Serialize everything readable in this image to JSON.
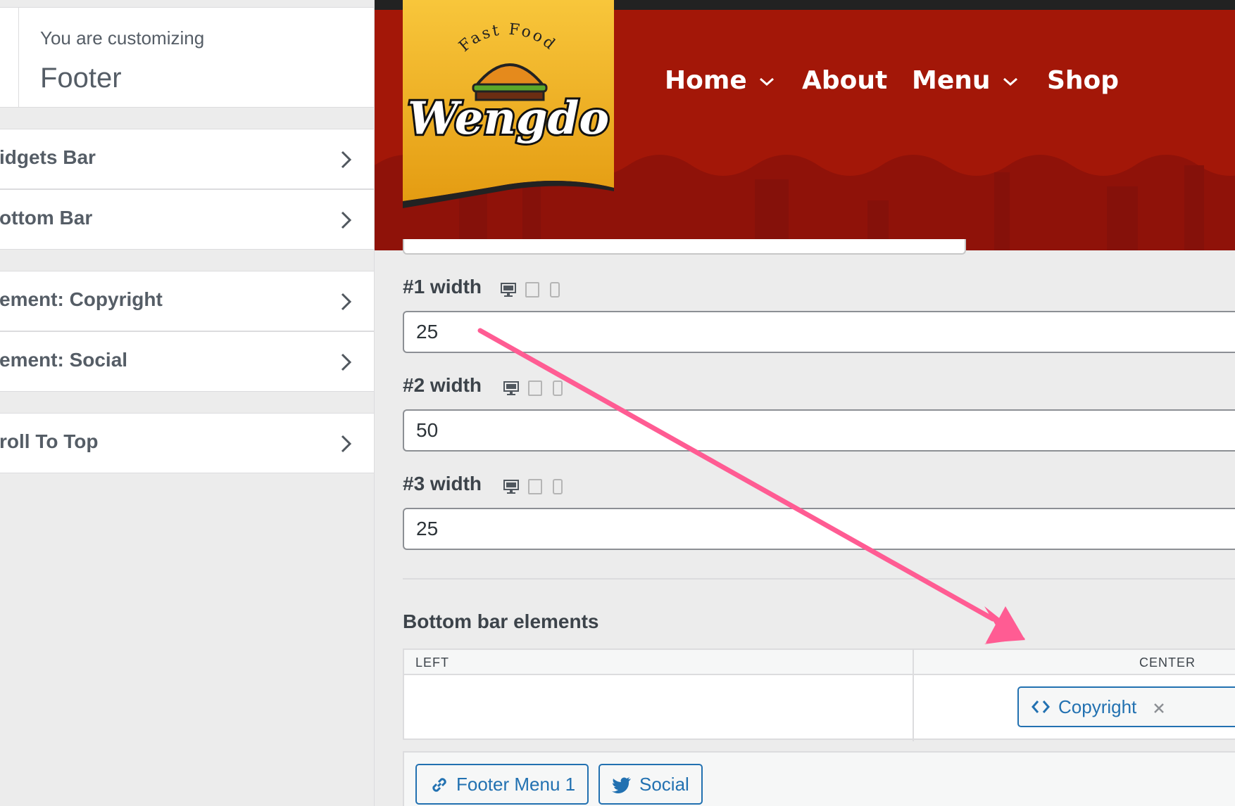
{
  "sidebar": {
    "customizing_label": "You are customizing",
    "customizing_title": "Footer",
    "sections": [
      {
        "label": "idgets Bar"
      },
      {
        "label": "ottom Bar"
      },
      {
        "label": "ement: Copyright"
      },
      {
        "label": "ement: Social"
      },
      {
        "label": "roll To Top"
      }
    ]
  },
  "site": {
    "logo": {
      "tagline": "Fast Food",
      "name": "Wengdo"
    },
    "nav": [
      {
        "label": "Home",
        "has_dropdown": true
      },
      {
        "label": "About",
        "has_dropdown": false
      },
      {
        "label": "Menu",
        "has_dropdown": true
      },
      {
        "label": "Shop",
        "has_dropdown": false
      }
    ],
    "colors": {
      "header_bg": "#a31708",
      "logo_bg": "#f2b21b"
    }
  },
  "controls": {
    "widths": [
      {
        "label": "#1 width",
        "value": "25"
      },
      {
        "label": "#2 width",
        "value": "50"
      },
      {
        "label": "#3 width",
        "value": "25"
      }
    ],
    "device_icons": [
      "desktop-icon",
      "tablet-icon",
      "mobile-icon"
    ],
    "bottom_bar_title": "Bottom bar elements",
    "zones": {
      "left": "LEFT",
      "center": "CENTER"
    },
    "center_elements": [
      {
        "label": "Copyright",
        "icon": "code-icon"
      }
    ],
    "available_elements": [
      {
        "label": "Footer Menu 1",
        "icon": "link-icon"
      },
      {
        "label": "Social",
        "icon": "twitter-icon"
      }
    ]
  },
  "annotation": {
    "arrow_color": "#ff5c93"
  }
}
